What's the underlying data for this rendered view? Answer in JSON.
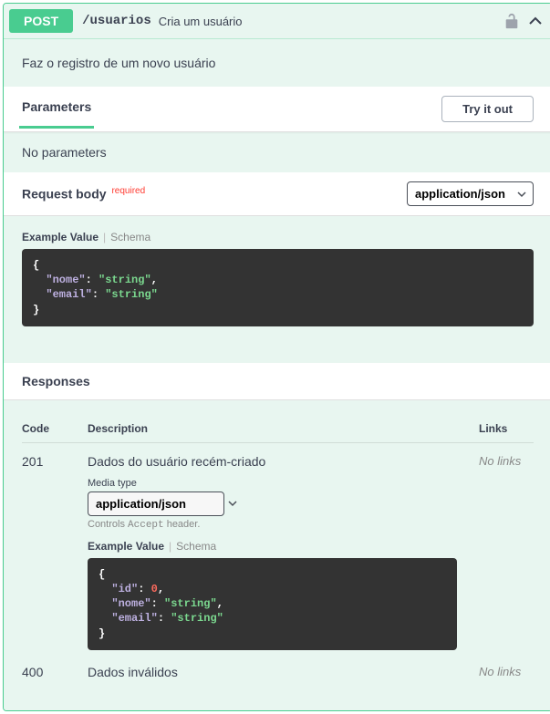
{
  "method": "POST",
  "path": "/usuarios",
  "summary": "Cria um usuário",
  "description": "Faz o registro de um novo usuário",
  "parameters_label": "Parameters",
  "tryit_label": "Try it out",
  "no_params": "No parameters",
  "request_body_label": "Request body",
  "required_label": "required",
  "content_type_options": [
    "application/json"
  ],
  "content_type_selected": "application/json",
  "example_tab": "Example Value",
  "schema_tab": "Schema",
  "request_example": {
    "open": "{",
    "l1k": "\"nome\"",
    "l1s": ": ",
    "l1v": "\"string\"",
    "l1c": ",",
    "l2k": "\"email\"",
    "l2s": ": ",
    "l2v": "\"string\"",
    "close": "}"
  },
  "responses_label": "Responses",
  "table_head": {
    "code": "Code",
    "desc": "Description",
    "links": "Links"
  },
  "responses": {
    "r201": {
      "code": "201",
      "msg": "Dados do usuário recém-criado",
      "media_label": "Media type",
      "media_selected": "application/json",
      "controls_pre": "Controls ",
      "controls_mono": "Accept",
      "controls_post": " header.",
      "example": {
        "open": "{",
        "l1k": "\"id\"",
        "l1s": ": ",
        "l1v": "0",
        "l1c": ",",
        "l2k": "\"nome\"",
        "l2s": ": ",
        "l2v": "\"string\"",
        "l2c": ",",
        "l3k": "\"email\"",
        "l3s": ": ",
        "l3v": "\"string\"",
        "close": "}"
      },
      "links": "No links"
    },
    "r400": {
      "code": "400",
      "msg": "Dados inválidos",
      "links": "No links"
    }
  }
}
